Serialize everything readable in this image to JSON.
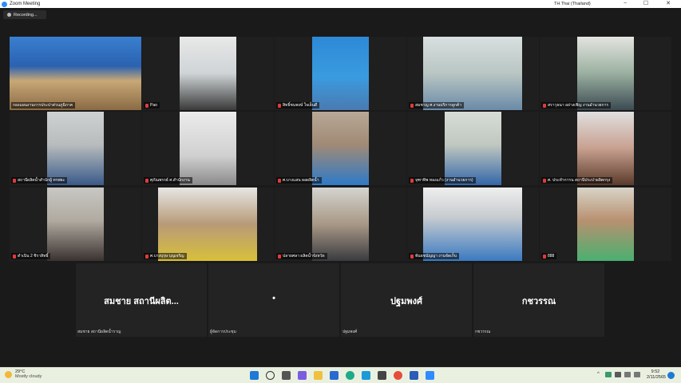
{
  "window": {
    "title": "Zoom Meeting",
    "language": "TH Thai (Thailand)",
    "minimize": "−",
    "maximize": "☐",
    "close": "✕"
  },
  "recording": {
    "label": "Recording..."
  },
  "participants": [
    {
      "name": "กองแผนงานการประปาส่วนภูมิภาค",
      "muted": false,
      "active": true
    },
    {
      "name": "Pao",
      "muted": true
    },
    {
      "name": "สิทธิ์ชนพงษ์ ใจเย็นดี",
      "muted": true
    },
    {
      "name": "สมชาญ ศ.งานบริการลูกค้า",
      "muted": true
    },
    {
      "name": "สราวุธนา อย่างเชิญ งานอำนวยการ",
      "muted": true
    },
    {
      "name": "สถานีผลิตน้ำสำนักผู้ ทรพยะ",
      "muted": true
    },
    {
      "name": "ศุภัณพรรธ์ ศ.สำนักงาน",
      "muted": true
    },
    {
      "name": "ศ.บางแสน ผลผลิตน้ำ",
      "muted": true
    },
    {
      "name": "จุฑาทิพ ทองแก้ว (งานอำนวยการ)",
      "muted": true
    },
    {
      "name": "ศ. ประทำการน สถานีประปาผลิตกรุง",
      "muted": true
    },
    {
      "name": "ดำเนิน 2 ชิราสิทธิ์",
      "muted": true
    },
    {
      "name": "ศ.บางบุรุษ บุญเจริญ",
      "muted": true
    },
    {
      "name": "ปลายศลา ผลิตน้ำจังหวัด",
      "muted": true
    },
    {
      "name": "พันธชนัญญา งานจัดเก็บ",
      "muted": true
    },
    {
      "name": "888",
      "muted": true
    }
  ],
  "name_tiles": [
    {
      "display": "สมชาย สถานีผลิต...",
      "name": "สมชาย สถานีผลิตน้ำราญ"
    },
    {
      "display": "•",
      "name": "ผู้จัดการประชุม"
    },
    {
      "display": "ปฐมพงศ์",
      "name": "ปฐมพงศ์"
    },
    {
      "display": "กชวรรณ",
      "name": "กชวรรณ"
    }
  ],
  "taskbar": {
    "weather_temp": "29°C",
    "weather_condition": "Mostly cloudy",
    "time": "9:52",
    "date": "2/11/2565",
    "tray_chevron": "^",
    "tray_lang": "ENG"
  }
}
